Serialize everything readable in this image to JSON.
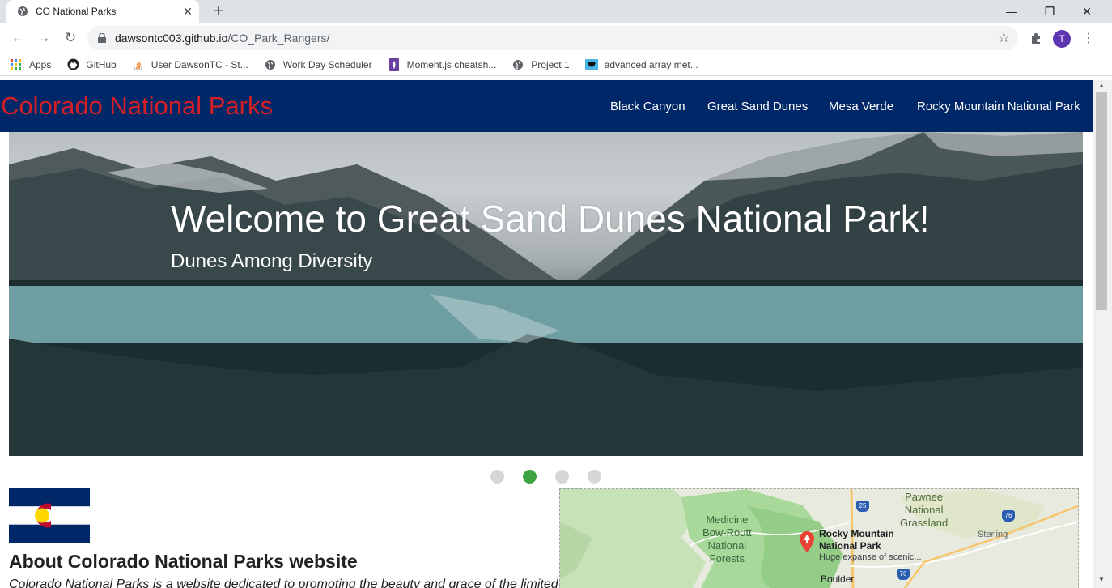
{
  "browser": {
    "tab_title": "CO National Parks",
    "new_tab": "+",
    "url_host": "dawsontc003.github.io",
    "url_path": "/CO_Park_Rangers/",
    "avatar_letter": "T"
  },
  "bookmarks": [
    {
      "label": "Apps",
      "icon": "apps-grid-icon"
    },
    {
      "label": "GitHub",
      "icon": "github-icon"
    },
    {
      "label": "User DawsonTC - St...",
      "icon": "stackoverflow-icon"
    },
    {
      "label": "Work Day Scheduler",
      "icon": "globe-icon"
    },
    {
      "label": "Moment.js cheatsh...",
      "icon": "moment-icon"
    },
    {
      "label": "Project 1",
      "icon": "globe-icon"
    },
    {
      "label": "advanced array met...",
      "icon": "bookmark-site-icon"
    }
  ],
  "site": {
    "brand": "Colorado National Parks",
    "nav": [
      "Black Canyon",
      "Great Sand Dunes",
      "Mesa Verde",
      "Rocky Mountain National Park"
    ]
  },
  "hero": {
    "title": "Welcome to Great Sand Dunes National Park!",
    "subtitle": "Dunes Among Diversity",
    "slide_count": 4,
    "active_slide": 2
  },
  "about": {
    "title": "About Colorado National Parks website",
    "text": "Colorado National Parks is a website dedicated to promoting the beauty and grace of the limited"
  },
  "map": {
    "labels": {
      "medicine": "Medicine\nBow-Routt\nNational\nForests",
      "pawnee": "Pawnee\nNational\nGrassland",
      "rmnp": "Rocky Mountain\nNational Park",
      "rmnp_sub": "Huge expanse of scenic...",
      "boulder": "Boulder",
      "sterling": "Sterling"
    },
    "shields": [
      "25",
      "76",
      "76"
    ]
  },
  "colors": {
    "nav_bg": "#002868",
    "brand": "#d41f26",
    "active_dot": "#3ca441"
  }
}
